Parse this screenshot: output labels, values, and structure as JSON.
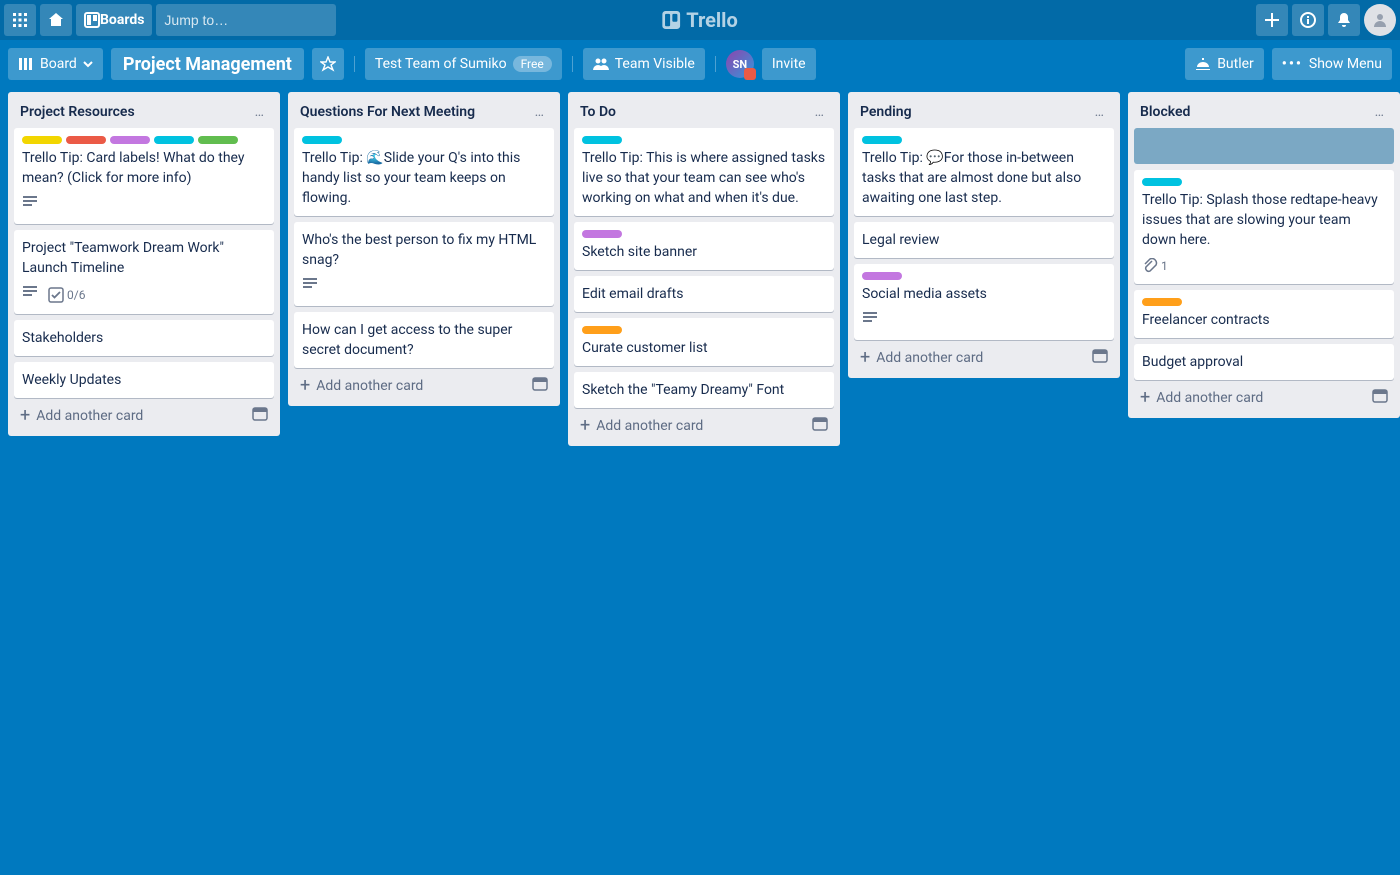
{
  "header": {
    "boards_label": "Boards",
    "search_placeholder": "Jump to…",
    "brand": "Trello"
  },
  "boardbar": {
    "view_label": "Board",
    "title": "Project Management",
    "team_label": "Test Team of Sumiko",
    "team_pill": "Free",
    "visibility": "Team Visible",
    "member_initials": "SN",
    "invite": "Invite",
    "butler": "Butler",
    "show_menu": "Show Menu"
  },
  "labels_palette": {
    "yellow": "#f2d600",
    "red": "#eb5a46",
    "purple": "#c377e0",
    "sky": "#00c2e0",
    "green": "#61bd4f",
    "orange": "#ff9f1a"
  },
  "add_card_label": "Add another card",
  "lists": [
    {
      "title": "Project Resources",
      "cards": [
        {
          "labels": [
            "yellow",
            "red",
            "purple",
            "sky",
            "green"
          ],
          "title": "Trello Tip: Card labels! What do they mean? (Click for more info)",
          "badges": {
            "desc": true
          }
        },
        {
          "title": "Project \"Teamwork Dream Work\" Launch Timeline",
          "badges": {
            "desc": true,
            "checklist": "0/6"
          }
        },
        {
          "title": "Stakeholders"
        },
        {
          "title": "Weekly Updates"
        }
      ]
    },
    {
      "title": "Questions For Next Meeting",
      "cards": [
        {
          "labels": [
            "sky"
          ],
          "title": "Trello Tip: 🌊Slide your Q's into this handy list so your team keeps on flowing."
        },
        {
          "title": "Who's the best person to fix my HTML snag?",
          "badges": {
            "desc": true
          }
        },
        {
          "title": "How can I get access to the super secret document?"
        }
      ]
    },
    {
      "title": "To Do",
      "cards": [
        {
          "labels": [
            "sky"
          ],
          "title": "Trello Tip: This is where assigned tasks live so that your team can see who's working on what and when it's due."
        },
        {
          "labels": [
            "purple"
          ],
          "title": "Sketch site banner"
        },
        {
          "title": "Edit email drafts"
        },
        {
          "labels": [
            "orange"
          ],
          "title": "Curate customer list"
        },
        {
          "title": "Sketch the \"Teamy Dreamy\" Font"
        }
      ]
    },
    {
      "title": "Pending",
      "cards": [
        {
          "labels": [
            "sky"
          ],
          "title": "Trello Tip: 💬For those in-between tasks that are almost done but also awaiting one last step."
        },
        {
          "title": "Legal review"
        },
        {
          "labels": [
            "purple"
          ],
          "title": "Social media assets",
          "badges": {
            "desc": true
          }
        }
      ]
    },
    {
      "title": "Blocked",
      "cards": [
        {
          "placeholder": true
        },
        {
          "labels": [
            "sky"
          ],
          "title": "Trello Tip: Splash those redtape-heavy issues that are slowing your team down here.",
          "badges": {
            "attachments": "1"
          }
        },
        {
          "labels": [
            "orange"
          ],
          "title": "Freelancer contracts"
        },
        {
          "title": "Budget approval"
        }
      ]
    }
  ]
}
